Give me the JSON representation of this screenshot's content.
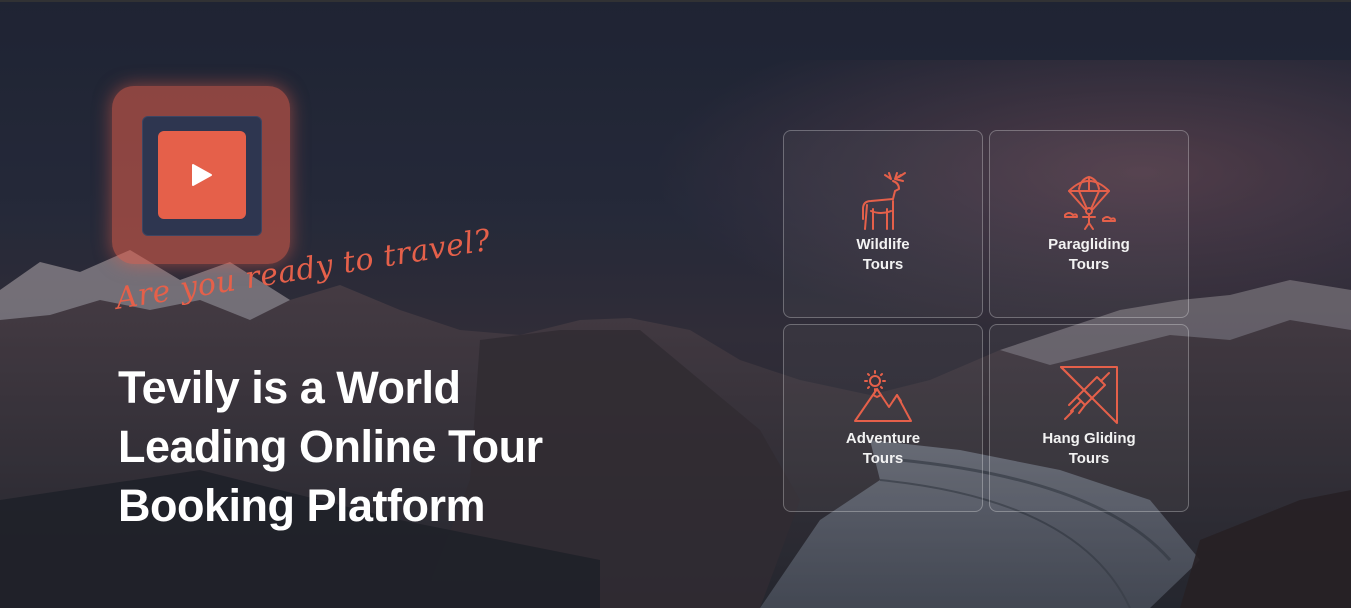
{
  "hero": {
    "play_icon": "play-icon",
    "tagline": "Are you ready to travel?",
    "headline_lines": [
      "Tevily is a World",
      "Leading Online Tour",
      "Booking Platform"
    ],
    "accent_color": "#e5604a"
  },
  "tours": [
    {
      "line1": "Wildlife",
      "line2": "Tours",
      "icon": "deer-icon"
    },
    {
      "line1": "Paragliding",
      "line2": "Tours",
      "icon": "paraglider-icon"
    },
    {
      "line1": "Adventure",
      "line2": "Tours",
      "icon": "mountain-sun-icon"
    },
    {
      "line1": "Hang Gliding",
      "line2": "Tours",
      "icon": "hang-glider-icon"
    }
  ]
}
